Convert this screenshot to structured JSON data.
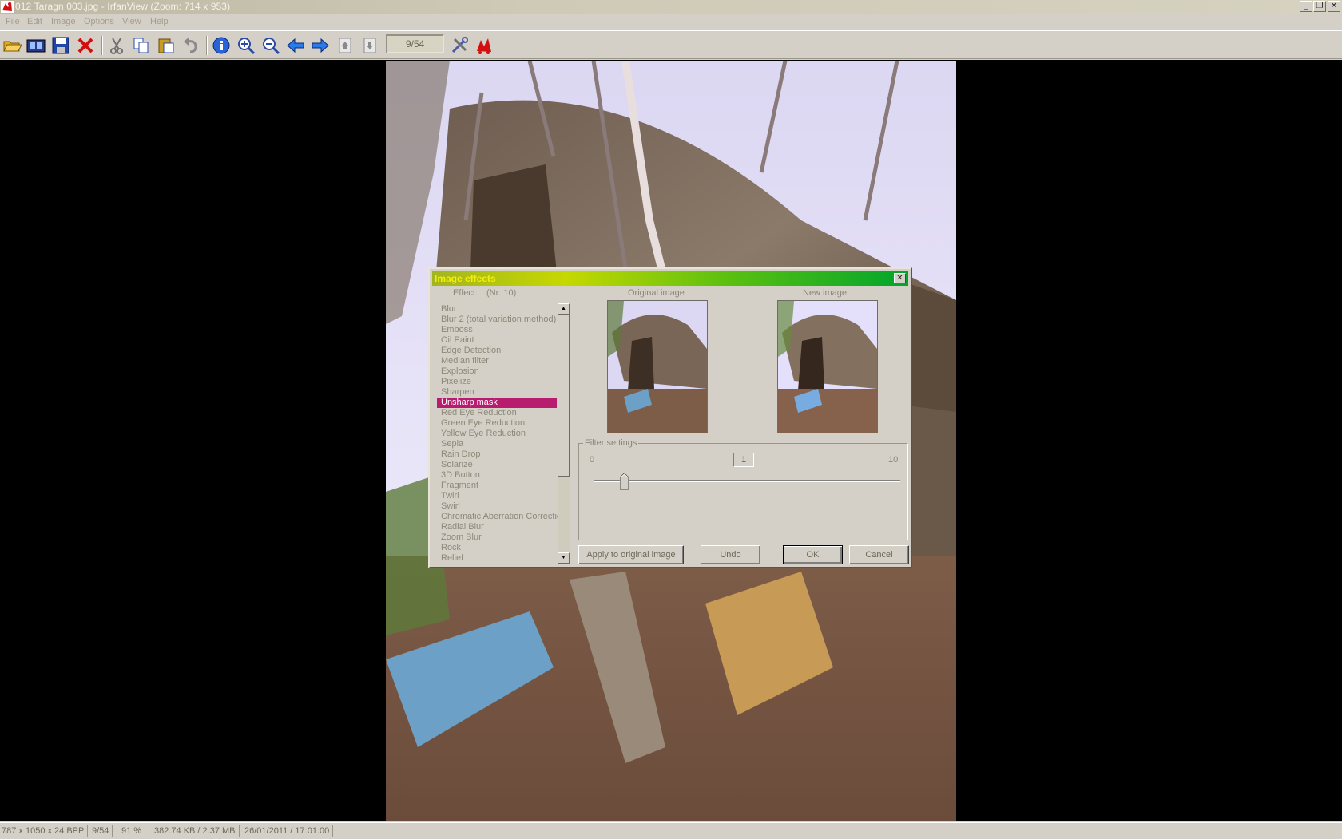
{
  "window": {
    "title": "012 Taragn 003.jpg - IrfanView (Zoom: 714 x 953)",
    "controls": {
      "minimize": "_",
      "maximize": "❐",
      "close": "✕"
    }
  },
  "menu": [
    "File",
    "Edit",
    "Image",
    "Options",
    "View",
    "Help"
  ],
  "toolbar": {
    "page_counter": "9/54",
    "icons": [
      "open-folder-icon",
      "slideshow-icon",
      "save-icon",
      "delete-icon",
      "cut-icon",
      "copy-icon",
      "paste-icon",
      "undo-icon",
      "info-icon",
      "zoom-in-icon",
      "zoom-out-icon",
      "previous-icon",
      "next-icon",
      "first-page-icon",
      "last-page-icon",
      "settings-icon",
      "irfanview-logo-icon"
    ]
  },
  "dialog": {
    "title": "Image effects",
    "effect_label": "Effect:",
    "effect_number": "(Nr: 10)",
    "original_label": "Original image",
    "new_label": "New image",
    "effects": [
      "Blur",
      "Blur 2 (total variation method)",
      "Emboss",
      "Oil Paint",
      "Edge Detection",
      "Median filter",
      "Explosion",
      "Pixelize",
      "Sharpen",
      "Unsharp mask",
      "Red Eye Reduction",
      "Green Eye Reduction",
      "Yellow Eye Reduction",
      "Sepia",
      "Rain Drop",
      "Solarize",
      "3D Button",
      "Fragment",
      "Twirl",
      "Swirl",
      "Chromatic Aberration Correction",
      "Radial Blur",
      "Zoom Blur",
      "Rock",
      "Relief"
    ],
    "selected_effect": "Unsharp mask",
    "filter_settings": {
      "label": "Filter settings",
      "min_label": "0",
      "max_label": "10",
      "value": "1",
      "slider_fraction": 0.1
    },
    "buttons": {
      "apply": "Apply to original image",
      "undo": "Undo",
      "ok": "OK",
      "cancel": "Cancel"
    }
  },
  "statusbar": {
    "dimensions": "787 x 1050 x 24 BPP",
    "index": "9/54",
    "zoom": "91 %",
    "filesize": "382.74 KB / 2.37 MB",
    "date": "26/01/2011 / 17:01:00"
  },
  "colors": {
    "selection": "#b71c6e",
    "dialog_title_start": "#a2b51f",
    "dialog_title_end": "#00a52c",
    "dialog_title_text": "#f7ee00"
  }
}
